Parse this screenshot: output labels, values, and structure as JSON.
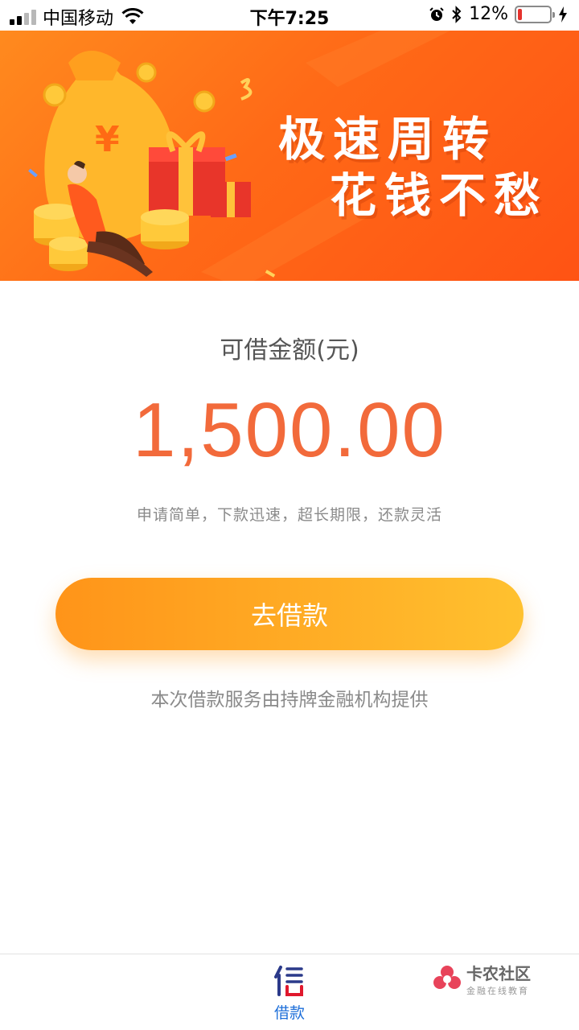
{
  "status_bar": {
    "carrier": "中国移动",
    "time": "下午7:25",
    "battery": "12%",
    "battery_level": 0.12
  },
  "banner": {
    "line1": "极速周转",
    "line2": "花钱不愁"
  },
  "main": {
    "amount_label": "可借金额(元)",
    "amount": "1,500.00",
    "slogan": "申请简单，下款迅速，超长期限，还款灵活",
    "borrow_button": "去借款",
    "provider_note": "本次借款服务由持牌金融机构提供"
  },
  "tabbar": {
    "tabs": [
      {
        "label": "借款",
        "icon": "xin-logo-icon",
        "active": true
      }
    ]
  },
  "watermark": {
    "name": "卡农社区",
    "sub": "金融在线教育"
  },
  "colors": {
    "accent": "#f26a3b",
    "button_start": "#ff9419",
    "button_end": "#ffc12f",
    "tab_active": "#1e6fd9"
  }
}
